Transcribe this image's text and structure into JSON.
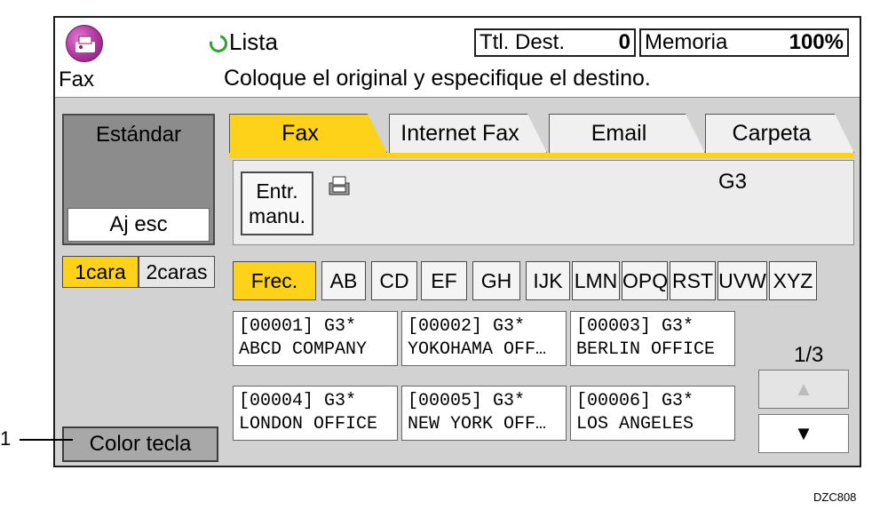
{
  "header": {
    "app_label": "Fax",
    "status": "Lista",
    "message": "Coloque el original y especifique el destino.",
    "total_dest_label": "Ttl. Dest.",
    "total_dest_value": "0",
    "memory_label": "Memoria",
    "memory_value": "100%"
  },
  "left_panel": {
    "title": "Estándar",
    "adjust_label": "Aj esc",
    "one_side_label": "1cara",
    "two_side_label": "2caras",
    "color_key_label": "Color tecla"
  },
  "tabs": [
    "Fax",
    "Internet Fax",
    "Email",
    "Carpeta"
  ],
  "entry": {
    "button_label_line1": "Entr.",
    "button_label_line2": "manu.",
    "line_type": "G3"
  },
  "letters": [
    "Frec.",
    "AB",
    "CD",
    "EF",
    "GH",
    "IJK",
    "LMN",
    "OPQ",
    "RST",
    "UVW",
    "XYZ"
  ],
  "destinations": [
    {
      "line1": "[00001] G3*",
      "line2": "ABCD COMPANY"
    },
    {
      "line1": "[00002] G3*",
      "line2": "YOKOHAMA OFF…"
    },
    {
      "line1": "[00003] G3*",
      "line2": "BERLIN OFFICE"
    },
    {
      "line1": "[00004] G3*",
      "line2": "LONDON OFFICE"
    },
    {
      "line1": "[00005] G3*",
      "line2": "NEW YORK OFF…"
    },
    {
      "line1": "[00006] G3*",
      "line2": "LOS ANGELES"
    }
  ],
  "pagination": {
    "indicator": "1/3",
    "up_glyph": "▲",
    "down_glyph": "▼"
  },
  "callout_number": "1",
  "figure_code": "DZC808",
  "colors": {
    "accent": "#ffd21a",
    "panel": "#d2d2d2",
    "ready": "#2ea32e"
  }
}
